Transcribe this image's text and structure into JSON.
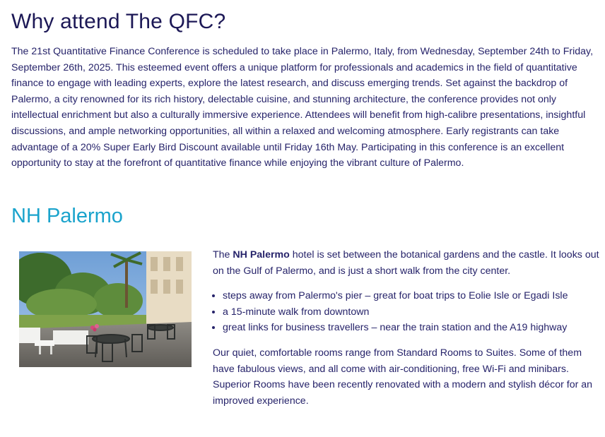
{
  "section1": {
    "title": "Why attend The QFC?",
    "body": "The 21st Quantitative Finance Conference is scheduled to take place in Palermo, Italy, from Wednesday, September 24th to Friday, September 26th, 2025. This esteemed event offers a unique platform for professionals and academics in the field of quantitative finance to engage with leading experts, explore the latest research, and discuss emerging trends. Set against the backdrop of Palermo, a city renowned for its rich history, delectable cuisine, and stunning architecture, the conference provides not only intellectual enrichment but also a culturally immersive experience. Attendees will benefit from high-calibre presentations, insightful discussions, and ample networking opportunities, all within a relaxed and welcoming atmosphere. Early registrants can take advantage of a 20% Super Early Bird Discount available until Friday 16th May. Participating in this conference is an excellent opportunity to stay at the forefront of quantitative finance while enjoying the vibrant culture of Palermo."
  },
  "hotel": {
    "title": "NH Palermo",
    "intro_prefix": "The ",
    "name": "NH Palermo",
    "intro_suffix": " hotel is set between the botanical gardens and the castle. It looks out on the Gulf of Palermo, and is just a short walk from the city center.",
    "bullets": [
      "steps away from Palermo's pier – great for boat trips to Eolie Isle or Egadi Isle",
      "a 15-minute walk from downtown",
      "great links for business travellers – near the train station and the A19 highway"
    ],
    "rooms_text": "Our quiet, comfortable rooms range from Standard Rooms to Suites. Some of them have fabulous views, and all come with air-conditioning, free Wi-Fi and minibars. Superior Rooms have been recently renovated with a modern and stylish décor for an improved experience."
  }
}
